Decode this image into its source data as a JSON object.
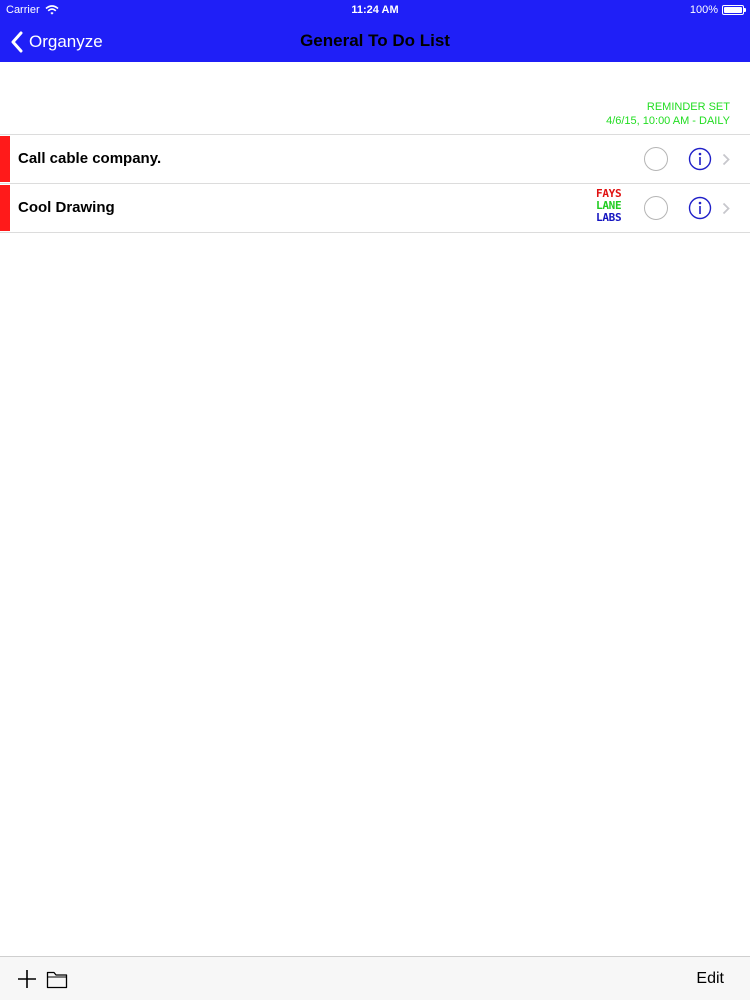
{
  "status_bar": {
    "carrier": "Carrier",
    "time": "11:24 AM",
    "battery": "100%"
  },
  "nav": {
    "back_label": "Organyze",
    "title": "General To Do List",
    "bar_color": "#1f1ff7"
  },
  "reminder": {
    "line1": "REMINDER SET",
    "line2": "4/6/15, 10:00 AM - DAILY",
    "color": "#22dd22"
  },
  "items": [
    {
      "title": "Call cable company.",
      "color": "#ff1a1a",
      "logo": null
    },
    {
      "title": "Cool Drawing",
      "color": "#ff1a1a",
      "logo": [
        "FAYS",
        "LANE",
        "LABS"
      ]
    }
  ],
  "toolbar": {
    "add_icon": "plus-icon",
    "folder_icon": "folder-icon",
    "edit_label": "Edit"
  }
}
